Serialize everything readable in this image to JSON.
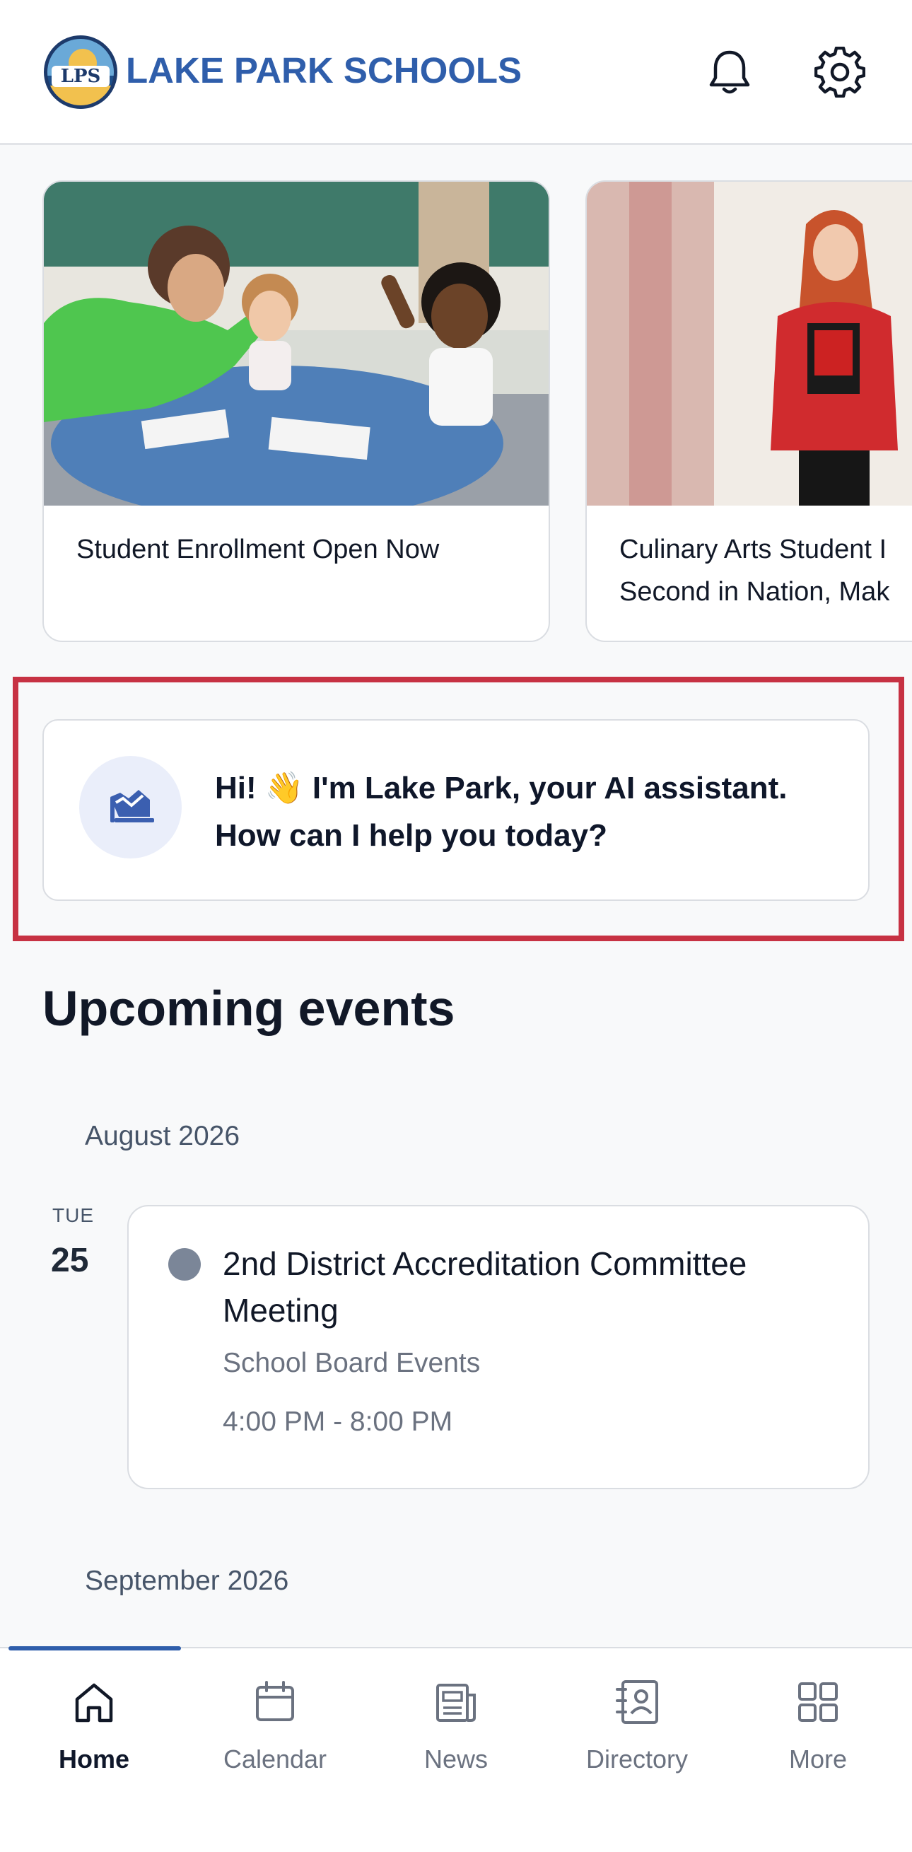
{
  "header": {
    "logo_text": "LPS",
    "brand": "LAKE PARK SCHOOLS",
    "notifications_icon": "bell-icon",
    "settings_icon": "gear-icon"
  },
  "carousel": {
    "items": [
      {
        "caption": "Student Enrollment Open Now",
        "image": "teacher high-fiving students in classroom"
      },
      {
        "caption_line1": "Culinary Arts Student I",
        "caption_line2": "Second in Nation, Mak",
        "image": "student in red blazer holding award plaque"
      }
    ]
  },
  "assistant": {
    "icon": "ai-assistant-icon",
    "message": "Hi! 👋 I'm Lake Park, your AI assistant. How can I help you today?"
  },
  "events": {
    "section_title": "Upcoming events",
    "months": [
      {
        "label": "August 2026",
        "days": [
          {
            "weekday": "TUE",
            "day": "25",
            "items": [
              {
                "title": "2nd District Accreditation Committee Meeting",
                "calendar": "School Board Events",
                "time": "4:00 PM - 8:00 PM"
              }
            ]
          }
        ]
      },
      {
        "label": "September 2026"
      }
    ]
  },
  "tabbar": {
    "tabs": [
      {
        "label": "Home",
        "icon": "home-icon",
        "active": true
      },
      {
        "label": "Calendar",
        "icon": "calendar-icon"
      },
      {
        "label": "News",
        "icon": "news-icon"
      },
      {
        "label": "Directory",
        "icon": "directory-icon"
      },
      {
        "label": "More",
        "icon": "grid-icon"
      }
    ]
  },
  "colors": {
    "brand": "#2f5eab",
    "highlight_outline": "#c73243",
    "event_dot": "#7b8698"
  }
}
